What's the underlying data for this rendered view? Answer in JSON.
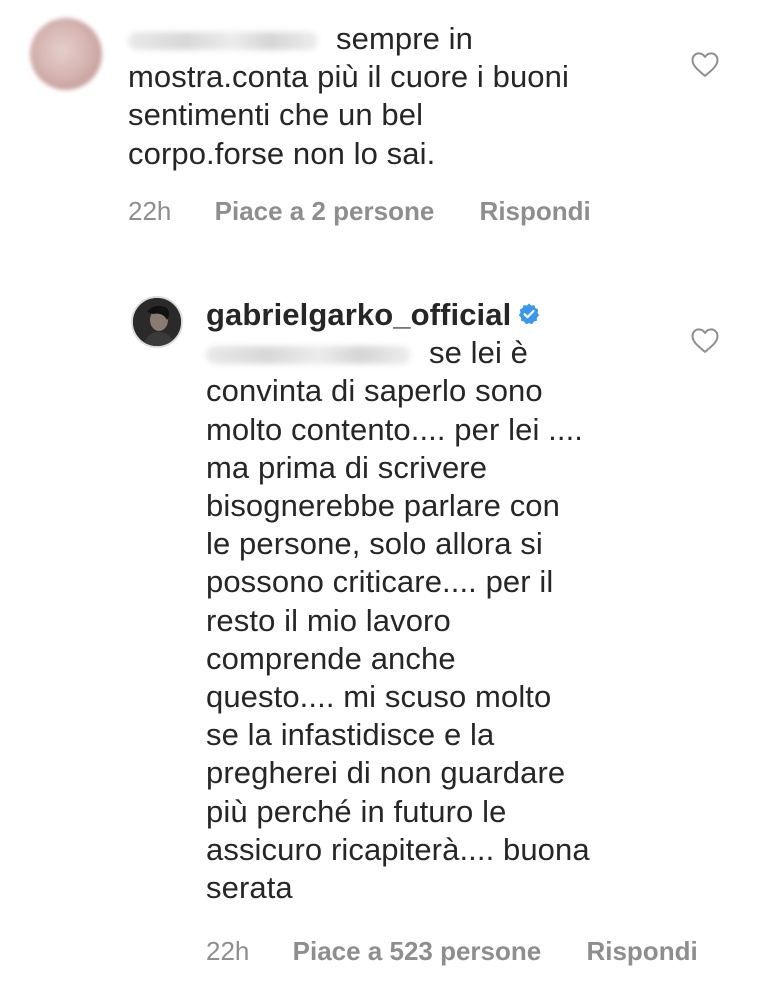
{
  "comments": [
    {
      "mention_hidden": true,
      "lines": [
        "sempre in",
        "mostra.conta più il cuore i buoni",
        "sentimenti che un bel",
        "corpo.forse non lo sai."
      ],
      "time": "22h",
      "likes": "Piace a 2 persone",
      "reply": "Rispondi"
    },
    {
      "username": "gabrielgarko_official",
      "verified": true,
      "mention_hidden": true,
      "lines": [
        "se lei è",
        "convinta di saperlo sono",
        "molto contento.... per lei ....",
        "ma prima di scrivere",
        "bisognerebbe parlare con",
        "le persone, solo allora si",
        "possono criticare.... per il",
        "resto il mio lavoro",
        "comprende anche",
        "questo.... mi scuso molto",
        "se la infastidisce e la",
        "pregherei di non guardare",
        "più perché in futuro le",
        "assicuro ricapiterà.... buona",
        "serata"
      ],
      "time": "22h",
      "likes": "Piace a 523 persone",
      "reply": "Rispondi"
    }
  ],
  "icons": {
    "like": "heart-outline-icon",
    "verified": "verified-badge-icon"
  },
  "colors": {
    "text": "#262626",
    "meta": "#8e8e8e",
    "verified": "#3897f0"
  }
}
